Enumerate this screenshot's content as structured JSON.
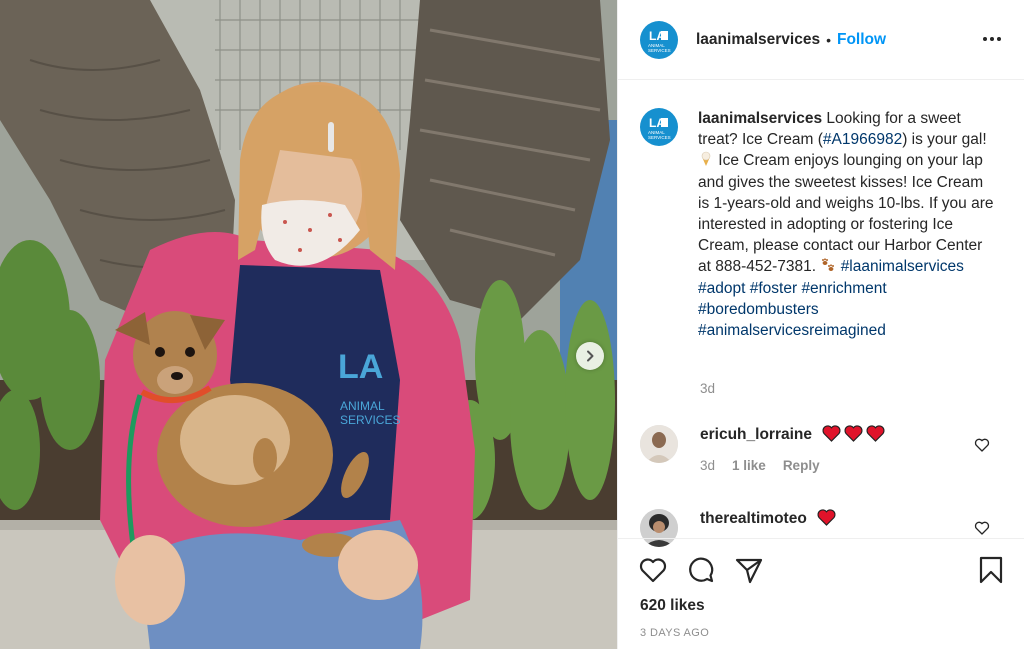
{
  "post": {
    "username": "laanimalservices",
    "follow_label": "Follow",
    "separator": "•",
    "logo_text_top": "LA",
    "logo_text_bottom": "ANIMAL SERVICES",
    "brand_color": "#1690cf"
  },
  "caption": {
    "username": "laanimalservices",
    "text_1": " Looking for a sweet treat? Ice Cream (",
    "tag_id": "#A1966982",
    "text_2": ") is your gal! ",
    "text_3": " Ice Cream enjoys lounging on your lap and gives the sweetest kisses! Ice Cream is 1-years-old and weighs 10-lbs. If you are interested in adopting or fostering Ice Cream, please contact our Harbor Center at 888-452-7381. ",
    "tags": [
      "#laanimalservices",
      "#adopt",
      "#foster",
      "#enrichment",
      "#boredombusters",
      "#animalservicesreimagined"
    ],
    "time": "3d",
    "emoji_icons": [
      "ice-cream-icon",
      "paw-prints-icon"
    ]
  },
  "comments": [
    {
      "username": "ericuh_lorraine",
      "emoji_count": 3,
      "time": "3d",
      "likes": "1 like",
      "reply_label": "Reply"
    },
    {
      "username": "therealtimoteo",
      "emoji_count": 1
    }
  ],
  "footer": {
    "likes": "620 likes",
    "date": "3 DAYS AGO",
    "icons": [
      "heart-icon",
      "comment-icon",
      "share-icon",
      "bookmark-icon"
    ]
  },
  "photo": {
    "shirt_logo_top": "LA",
    "shirt_logo_bottom": "ANIMAL SERVICES"
  }
}
